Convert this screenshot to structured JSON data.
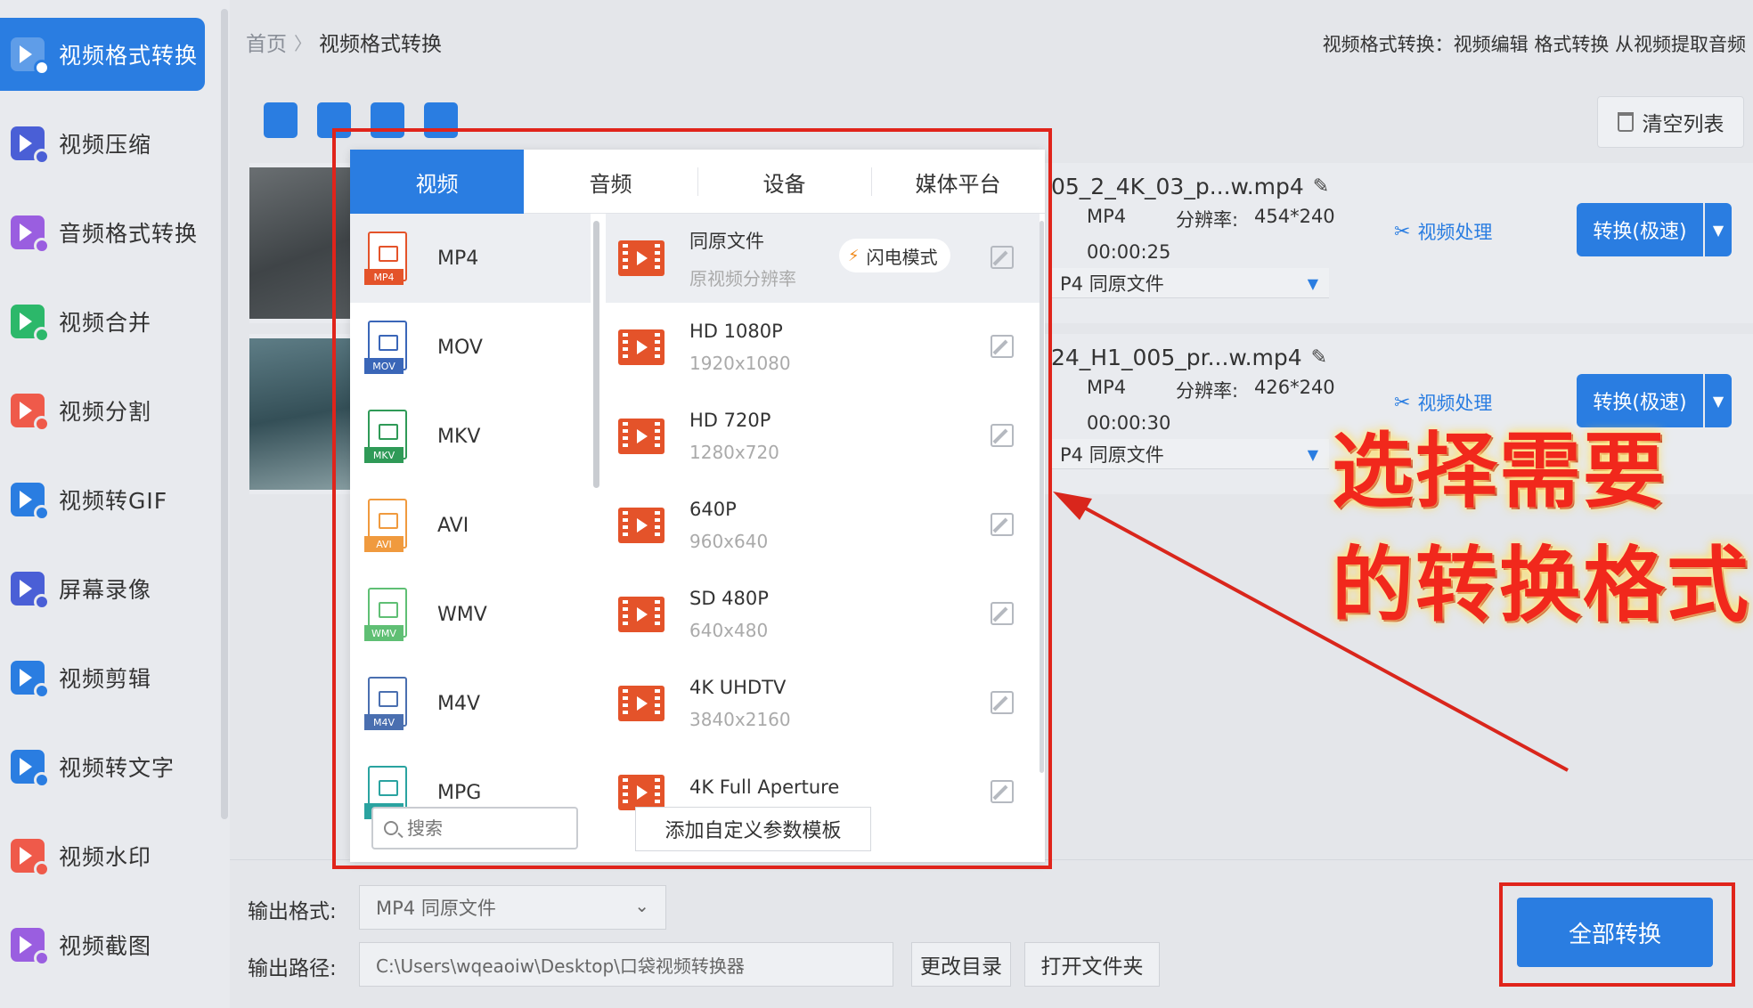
{
  "sidebar": {
    "items": [
      {
        "label": "视频格式转换",
        "icon": "video-convert-icon",
        "color": "#ffffff",
        "active": true
      },
      {
        "label": "视频压缩",
        "icon": "video-compress-icon",
        "color": "#4a5fd6"
      },
      {
        "label": "音频格式转换",
        "icon": "audio-convert-icon",
        "color": "#9a5ee0"
      },
      {
        "label": "视频合并",
        "icon": "video-merge-icon",
        "color": "#2cb86a"
      },
      {
        "label": "视频分割",
        "icon": "video-split-icon",
        "color": "#ef5a4a"
      },
      {
        "label": "视频转GIF",
        "icon": "video-gif-icon",
        "color": "#2a7de1"
      },
      {
        "label": "屏幕录像",
        "icon": "screen-record-icon",
        "color": "#4a5fd6"
      },
      {
        "label": "视频剪辑",
        "icon": "video-edit-icon",
        "color": "#2a7de1"
      },
      {
        "label": "视频转文字",
        "icon": "video-text-icon",
        "color": "#2a7de1"
      },
      {
        "label": "视频水印",
        "icon": "video-watermark-icon",
        "color": "#ef5a4a"
      },
      {
        "label": "视频截图",
        "icon": "video-screenshot-icon",
        "color": "#9a5ee0"
      }
    ]
  },
  "header": {
    "breadcrumb_home": "首页",
    "breadcrumb_sep": "〉",
    "breadcrumb_current": "视频格式转换",
    "description": "视频格式转换：视频编辑 格式转换 从视频提取音频"
  },
  "toolbar": {
    "clear_label": "清空列表"
  },
  "files": [
    {
      "name": "05_2_4K_03_p...w.mp4",
      "format": "MP4",
      "resolution_label": "分辨率:",
      "resolution": "454*240",
      "duration": "00:00:25",
      "output": "P4  同原文件",
      "process_label": "视频处理",
      "convert_label": "转换(极速)"
    },
    {
      "name": "24_H1_005_pr...w.mp4",
      "format": "MP4",
      "resolution_label": "分辨率:",
      "resolution": "426*240",
      "duration": "00:00:30",
      "output": "P4  同原文件",
      "process_label": "视频处理",
      "convert_label": "转换(极速)"
    }
  ],
  "popup": {
    "tabs": [
      "视频",
      "音频",
      "设备",
      "媒体平台"
    ],
    "active_tab": 0,
    "formats": [
      {
        "name": "MP4",
        "tag": "MP4",
        "color": "#e4532a"
      },
      {
        "name": "MOV",
        "tag": "MOV",
        "color": "#3a66b8"
      },
      {
        "name": "MKV",
        "tag": "MKV",
        "color": "#2f9a57"
      },
      {
        "name": "AVI",
        "tag": "AVI",
        "color": "#f09a3e"
      },
      {
        "name": "WMV",
        "tag": "WMV",
        "color": "#5fbf74"
      },
      {
        "name": "M4V",
        "tag": "M4V",
        "color": "#4a6fb0"
      },
      {
        "name": "MPG",
        "tag": "MPG",
        "color": "#2aa3a0"
      }
    ],
    "search_placeholder": "搜索",
    "resolutions": [
      {
        "name": "同原文件",
        "size": "原视频分辨率",
        "badge": "闪电模式"
      },
      {
        "name": "HD 1080P",
        "size": "1920x1080"
      },
      {
        "name": "HD 720P",
        "size": "1280x720"
      },
      {
        "name": "640P",
        "size": "960x640"
      },
      {
        "name": "SD 480P",
        "size": "640x480"
      },
      {
        "name": "4K UHDTV",
        "size": "3840x2160"
      },
      {
        "name": "4K Full Aperture",
        "size": ""
      }
    ],
    "add_template_label": "添加自定义参数模板"
  },
  "bottom": {
    "format_label": "输出格式:",
    "format_value": "MP4  同原文件",
    "path_label": "输出路径:",
    "path_value": "C:\\Users\\wqeaoiw\\Desktop\\口袋视频转换器",
    "change_dir_label": "更改目录",
    "open_folder_label": "打开文件夹",
    "convert_all_label": "全部转换"
  },
  "annotation": {
    "line1": "选择需要",
    "line2": "的转换格式"
  }
}
